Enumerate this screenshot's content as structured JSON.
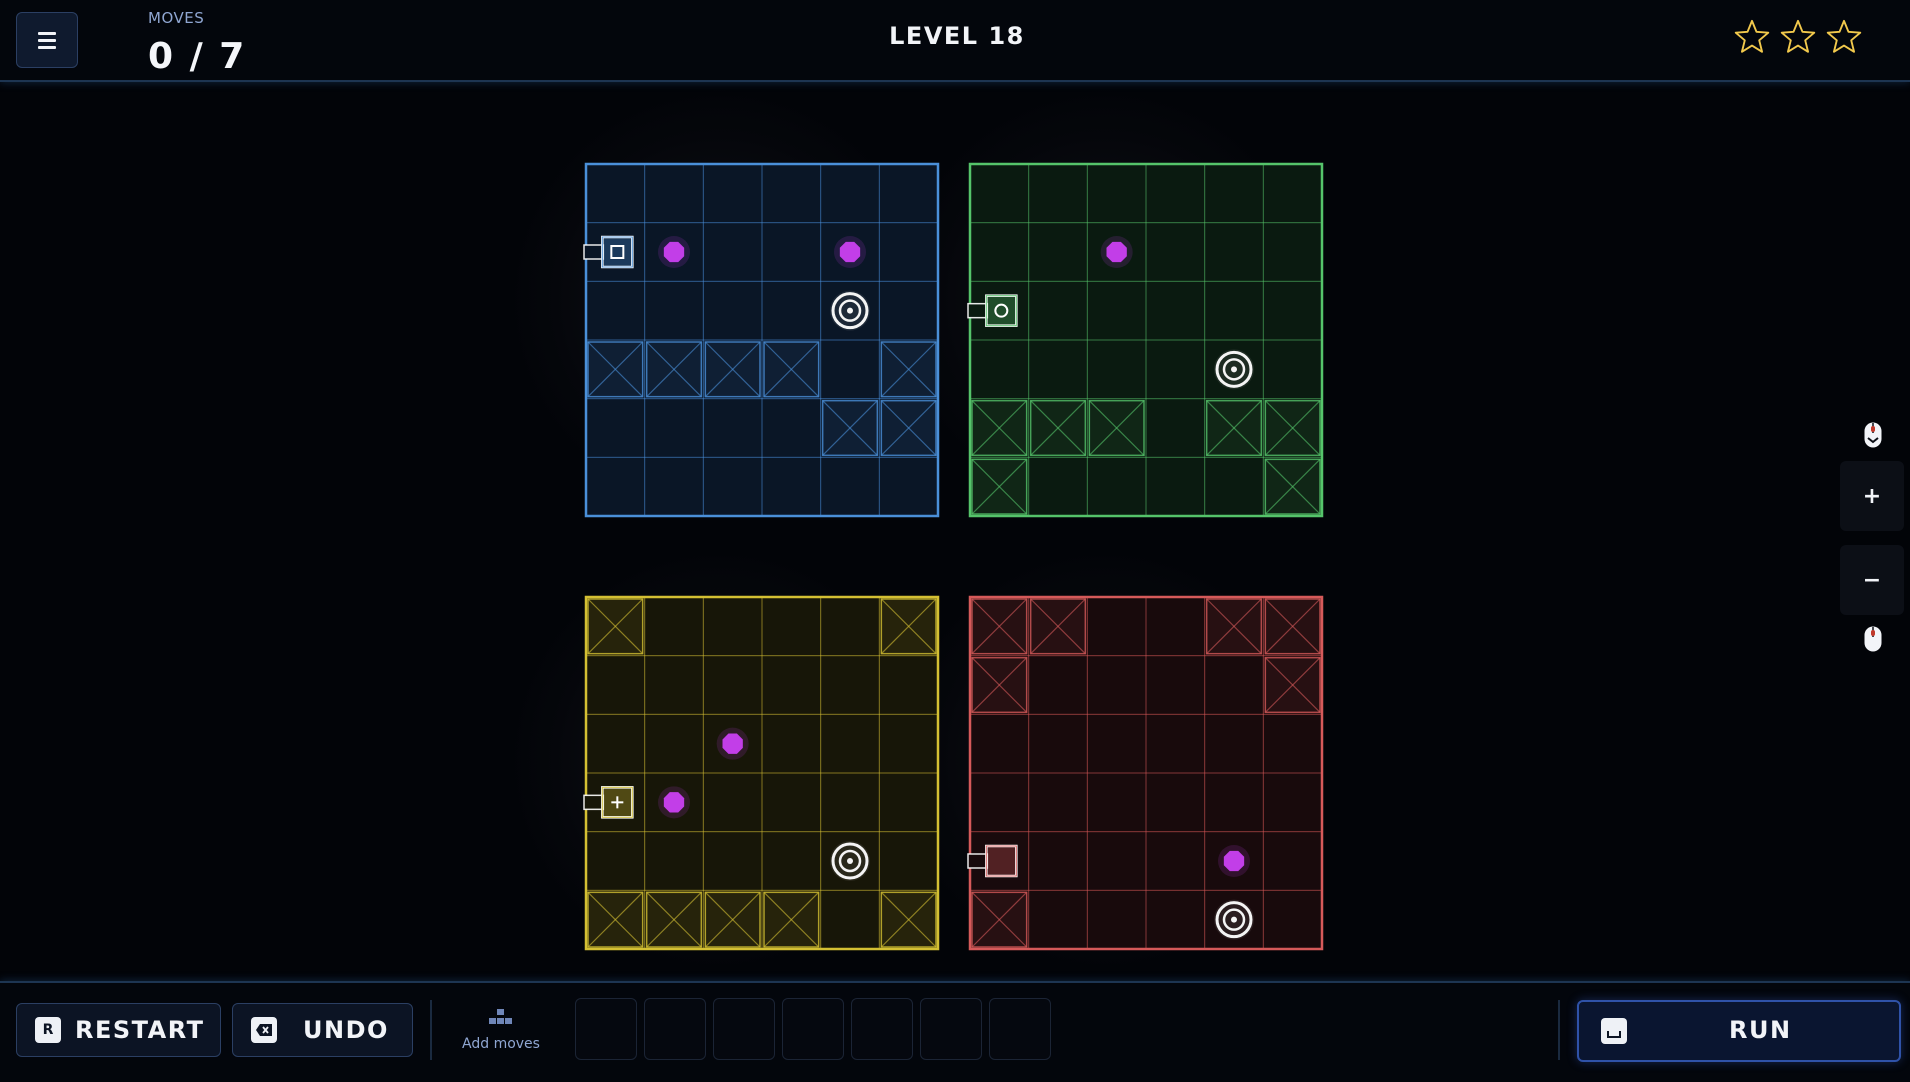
{
  "header": {
    "menu_icon": "hamburger-icon",
    "moves_label": "MOVES",
    "moves_count": "0 / 7",
    "level_title": "LEVEL 18",
    "stars": [
      {
        "filled": false,
        "icon": "star-outline-icon"
      },
      {
        "filled": false,
        "icon": "star-outline-icon"
      },
      {
        "filled": false,
        "icon": "star-outline-icon"
      }
    ],
    "star_color": "#f2c94c"
  },
  "boards": [
    {
      "name": "blue",
      "color": "#4a90d9",
      "fill": "#0a1626",
      "glyph": "square",
      "rows": 6,
      "cols": 6,
      "walls": [
        [
          3,
          0
        ],
        [
          3,
          1
        ],
        [
          3,
          2
        ],
        [
          3,
          3
        ],
        [
          3,
          5
        ],
        [
          4,
          4
        ],
        [
          4,
          5
        ]
      ],
      "gems": [
        [
          1,
          1
        ],
        [
          1,
          4
        ]
      ],
      "targets": [
        [
          2,
          4
        ]
      ],
      "robot": {
        "row": 1,
        "col": 0
      }
    },
    {
      "name": "green",
      "color": "#55c46a",
      "fill": "#0a1a10",
      "glyph": "circle",
      "rows": 6,
      "cols": 6,
      "walls": [
        [
          4,
          0
        ],
        [
          4,
          1
        ],
        [
          4,
          2
        ],
        [
          4,
          4
        ],
        [
          4,
          5
        ],
        [
          5,
          0
        ],
        [
          5,
          5
        ]
      ],
      "gems": [
        [
          1,
          2
        ]
      ],
      "targets": [
        [
          3,
          4
        ]
      ],
      "robot": {
        "row": 2,
        "col": 0
      }
    },
    {
      "name": "yellow",
      "color": "#d4c033",
      "fill": "#171608",
      "glyph": "plus",
      "rows": 6,
      "cols": 6,
      "walls": [
        [
          0,
          0
        ],
        [
          0,
          5
        ],
        [
          5,
          0
        ],
        [
          5,
          1
        ],
        [
          5,
          2
        ],
        [
          5,
          3
        ],
        [
          5,
          5
        ]
      ],
      "gems": [
        [
          2,
          2
        ],
        [
          3,
          1
        ]
      ],
      "targets": [
        [
          4,
          4
        ]
      ],
      "robot": {
        "row": 3,
        "col": 0
      }
    },
    {
      "name": "red",
      "color": "#d65a5a",
      "fill": "#180a0c",
      "glyph": "empty",
      "rows": 6,
      "cols": 6,
      "walls": [
        [
          0,
          0
        ],
        [
          0,
          1
        ],
        [
          0,
          4
        ],
        [
          0,
          5
        ],
        [
          1,
          0
        ],
        [
          1,
          5
        ],
        [
          5,
          0
        ]
      ],
      "gems": [
        [
          4,
          4
        ]
      ],
      "targets": [
        [
          5,
          4
        ]
      ],
      "robot": {
        "row": 4,
        "col": 0
      }
    }
  ],
  "gem_color": "#c23ee8",
  "zoom": {
    "zoom_in_label": "+",
    "zoom_out_label": "−",
    "scroll_up_icon": "mouse-scroll-up-icon",
    "scroll_down_icon": "mouse-scroll-down-icon"
  },
  "footer": {
    "restart_key": "R",
    "restart_label": "RESTART",
    "undo_icon": "backspace-icon",
    "undo_label": "UNDO",
    "add_moves_icon": "blocks-icon",
    "add_moves_label": "Add moves",
    "slot_count": 7,
    "run_icon": "spacebar-icon",
    "run_label": "RUN"
  }
}
